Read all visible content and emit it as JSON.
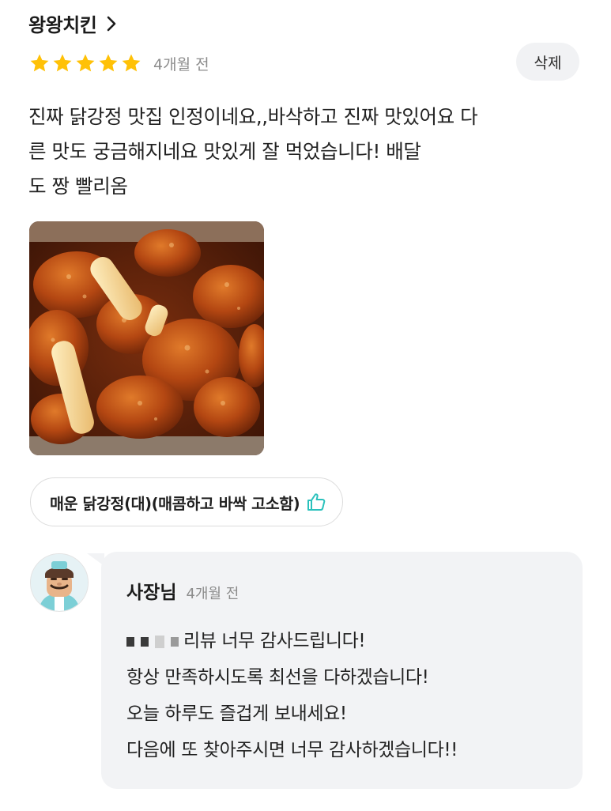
{
  "store": {
    "name": "왕왕치킨",
    "chevron_icon": "chevron-right-icon"
  },
  "review": {
    "rating": 5,
    "rating_max": 5,
    "star_color": "#ffc107",
    "time_ago": "4개월 전",
    "delete_label": "삭제",
    "text": "진짜 닭강정 맛집 인정이네요,,바삭하고 진짜 맛있어요 다\n른 맛도 궁금해지네요 맛있게 잘 먹었습니다! 배달\n도 짱 빨리옴",
    "photo_icon": "fried-chicken-photo",
    "menu_item": "매운 닭강정(대)(매콤하고 바싹 고소함)",
    "like_icon": "thumbs-up-icon",
    "like_color": "#2ac1bc"
  },
  "reply": {
    "owner_label": "사장님",
    "time_ago": "4개월 전",
    "avatar_icon": "owner-avatar-icon",
    "lines": [
      "리뷰 너무 감사드립니다!",
      "항상 만족하시도록 최선을 다하겠습니다!",
      "오늘 하루도 즐겁게 보내세요!",
      "다음에 또 찾아주시면 너무 감사하겠습니다!!"
    ]
  }
}
